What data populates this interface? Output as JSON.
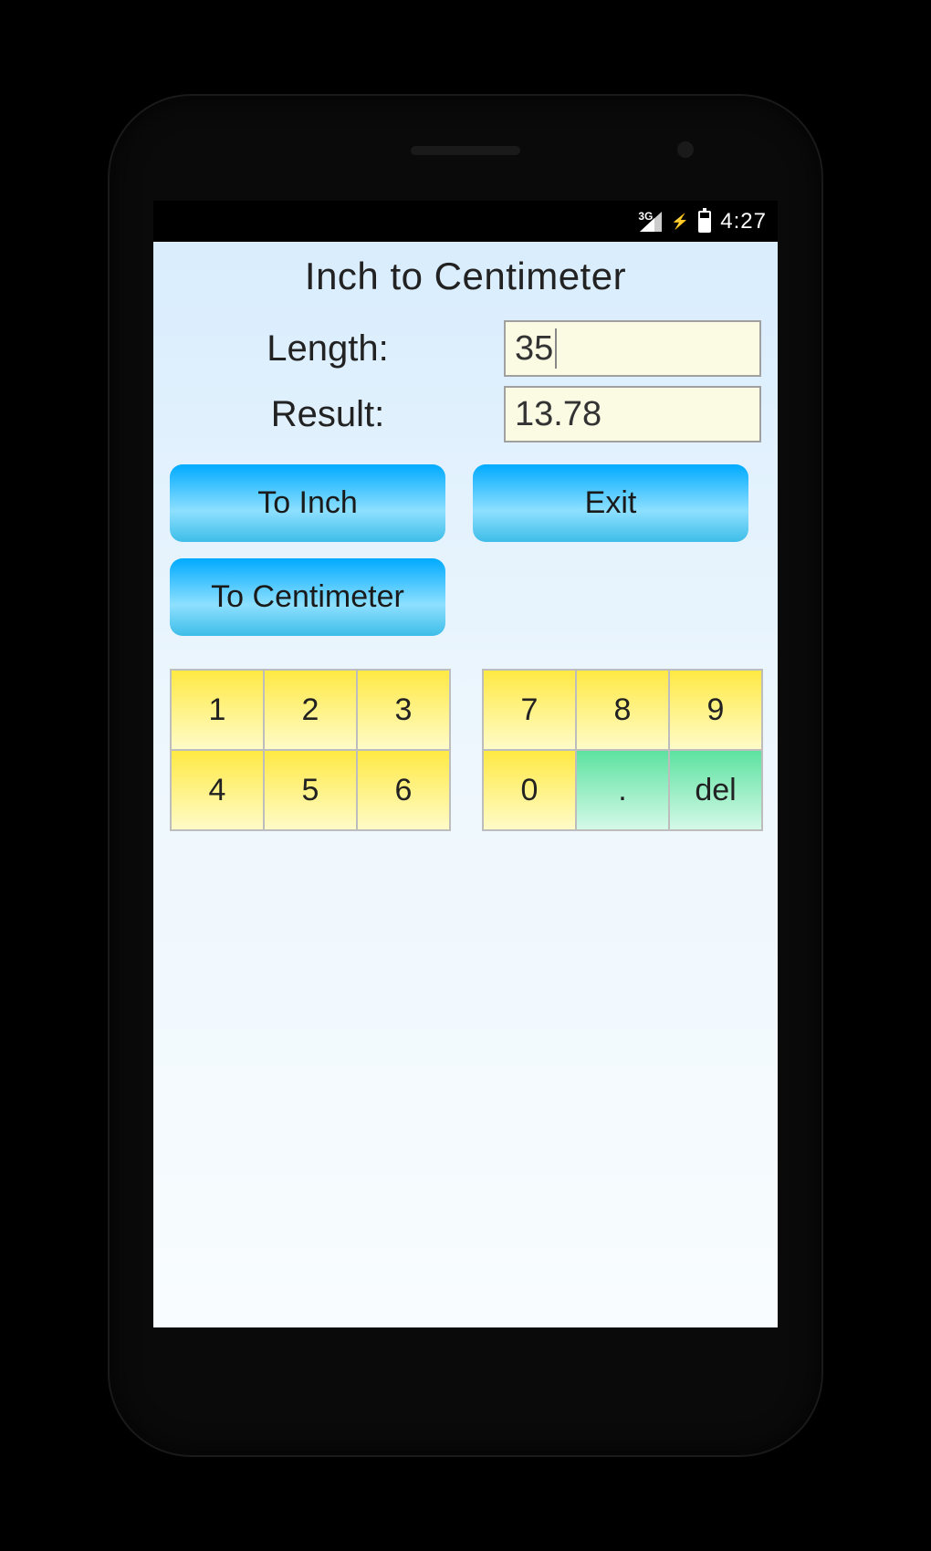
{
  "statusbar": {
    "network": "3G",
    "time": "4:27"
  },
  "app": {
    "title": "Inch to Centimeter",
    "length_label": "Length:",
    "result_label": "Result:",
    "length_value": "35",
    "result_value": "13.78"
  },
  "buttons": {
    "to_inch": "To Inch",
    "exit": "Exit",
    "to_centimeter": "To Centimeter"
  },
  "keypad": {
    "left": [
      "1",
      "2",
      "3",
      "4",
      "5",
      "6"
    ],
    "right": [
      "7",
      "8",
      "9",
      "0",
      ".",
      "del"
    ]
  }
}
